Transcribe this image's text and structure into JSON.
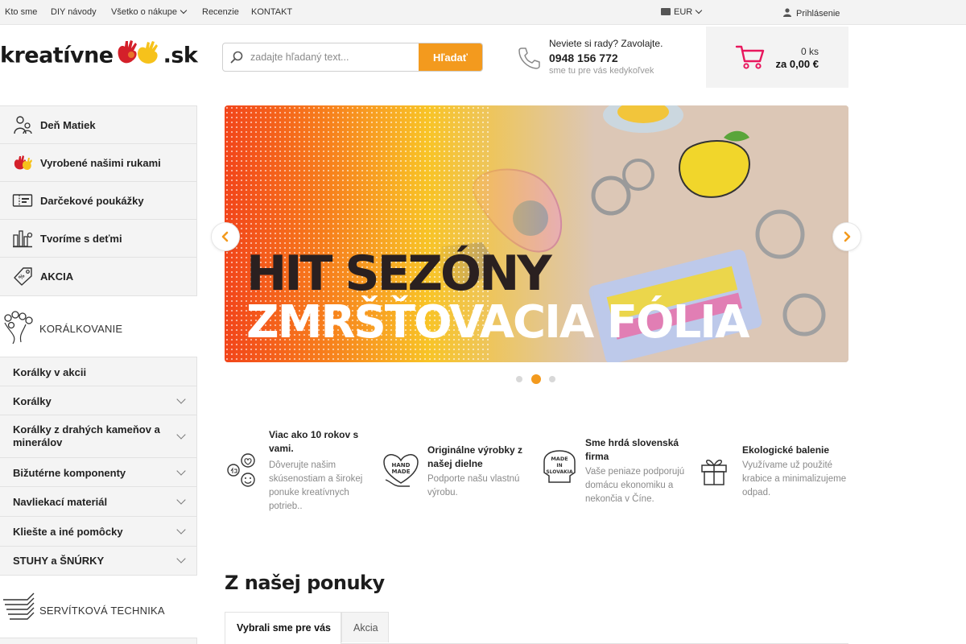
{
  "topbar": {
    "links": [
      "Kto sme",
      "DIY návody",
      "Všetko o nákupe",
      "Recenzie",
      "KONTAKT"
    ],
    "currency": "EUR",
    "login": "Prihlásenie"
  },
  "header": {
    "logo_left": "kreatívne",
    "logo_right": ".sk",
    "search_placeholder": "zadajte hľadaný text...",
    "search_button": "Hľadať",
    "phone_prompt": "Neviete si rady? Zavolajte.",
    "phone_number": "0948 156 772",
    "phone_note": "sme tu pre vás kedykoľvek",
    "cart_count": "0 ks",
    "cart_total": "za 0,00 €"
  },
  "sidebar": {
    "featured": [
      {
        "label": "Deň Matiek",
        "icon": "mother-child-icon"
      },
      {
        "label": "Vyrobené našimi rukami",
        "icon": "hands-icon"
      },
      {
        "label": "Darčekové poukážky",
        "icon": "voucher-icon"
      },
      {
        "label": "Tvoríme s deťmi",
        "icon": "crafting-kids-icon"
      },
      {
        "label": "AKCIA",
        "icon": "price-tag-icon"
      }
    ],
    "section1_title": "KORÁLKOVANIE",
    "section1_items": [
      {
        "label": "Korálky v akcii",
        "expandable": false
      },
      {
        "label": "Korálky",
        "expandable": true
      },
      {
        "label": "Korálky z drahých kameňov a minerálov",
        "expandable": true
      },
      {
        "label": "Bižutérne komponenty",
        "expandable": true
      },
      {
        "label": "Navliekací materiál",
        "expandable": true
      },
      {
        "label": "Kliešte a iné pomôcky",
        "expandable": true
      },
      {
        "label": "STUHY a ŠNÚRKY",
        "expandable": true
      }
    ],
    "section2_title": "SERVÍTKOVÁ TECHNIKA"
  },
  "banner": {
    "headline1": "HIT SEZÓNY",
    "headline2": "ZMRŠŤOVACIA FÓLIA",
    "slide_count": 3,
    "active_slide": 2
  },
  "benefits": [
    {
      "title": "Viac ako 10 rokov s vami.",
      "desc": "Dôverujte našim skúsenostiam a širokej ponuke kreatívnych potrieb..",
      "icon": "community-icon"
    },
    {
      "title": "Originálne výrobky z našej dielne",
      "desc": "Podporte našu vlastnú výrobu.",
      "icon": "handmade-icon"
    },
    {
      "title": "Sme hrdá slovenská firma",
      "desc": "Vaše peniaze podporujú domácu ekonomiku a nekončia v Číne.",
      "icon": "made-in-slovakia-icon",
      "badge_lines": [
        "MADE",
        "IN",
        "SLOVAKIA"
      ]
    },
    {
      "title": "Ekologické balenie",
      "desc": "Využívame už použité krabice a minimalizujeme odpad.",
      "icon": "gift-box-icon"
    }
  ],
  "handmade_badge": [
    "HAND",
    "MADE"
  ],
  "offers": {
    "title": "Z našej ponuky",
    "tabs": [
      "Vybrali sme pre vás",
      "Akcia"
    ]
  },
  "colors": {
    "accent": "#f39a1e",
    "cart_pink": "#e8175d",
    "sidebar_bg": "#f4f4f4"
  }
}
